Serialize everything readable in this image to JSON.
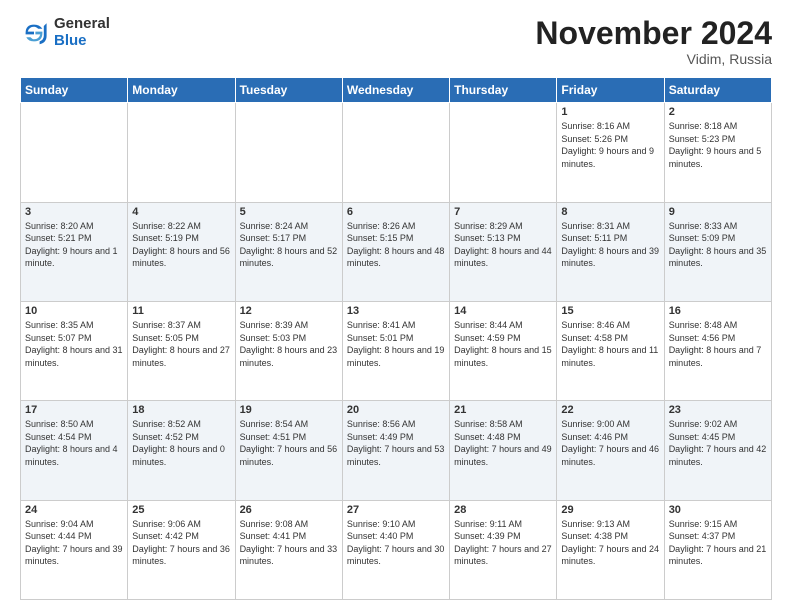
{
  "header": {
    "logo": {
      "general": "General",
      "blue": "Blue"
    },
    "title": "November 2024",
    "location": "Vidim, Russia"
  },
  "calendar": {
    "days_of_week": [
      "Sunday",
      "Monday",
      "Tuesday",
      "Wednesday",
      "Thursday",
      "Friday",
      "Saturday"
    ],
    "weeks": [
      [
        {
          "day": "",
          "info": ""
        },
        {
          "day": "",
          "info": ""
        },
        {
          "day": "",
          "info": ""
        },
        {
          "day": "",
          "info": ""
        },
        {
          "day": "",
          "info": ""
        },
        {
          "day": "1",
          "info": "Sunrise: 8:16 AM\nSunset: 5:26 PM\nDaylight: 9 hours and 9 minutes."
        },
        {
          "day": "2",
          "info": "Sunrise: 8:18 AM\nSunset: 5:23 PM\nDaylight: 9 hours and 5 minutes."
        }
      ],
      [
        {
          "day": "3",
          "info": "Sunrise: 8:20 AM\nSunset: 5:21 PM\nDaylight: 9 hours and 1 minute."
        },
        {
          "day": "4",
          "info": "Sunrise: 8:22 AM\nSunset: 5:19 PM\nDaylight: 8 hours and 56 minutes."
        },
        {
          "day": "5",
          "info": "Sunrise: 8:24 AM\nSunset: 5:17 PM\nDaylight: 8 hours and 52 minutes."
        },
        {
          "day": "6",
          "info": "Sunrise: 8:26 AM\nSunset: 5:15 PM\nDaylight: 8 hours and 48 minutes."
        },
        {
          "day": "7",
          "info": "Sunrise: 8:29 AM\nSunset: 5:13 PM\nDaylight: 8 hours and 44 minutes."
        },
        {
          "day": "8",
          "info": "Sunrise: 8:31 AM\nSunset: 5:11 PM\nDaylight: 8 hours and 39 minutes."
        },
        {
          "day": "9",
          "info": "Sunrise: 8:33 AM\nSunset: 5:09 PM\nDaylight: 8 hours and 35 minutes."
        }
      ],
      [
        {
          "day": "10",
          "info": "Sunrise: 8:35 AM\nSunset: 5:07 PM\nDaylight: 8 hours and 31 minutes."
        },
        {
          "day": "11",
          "info": "Sunrise: 8:37 AM\nSunset: 5:05 PM\nDaylight: 8 hours and 27 minutes."
        },
        {
          "day": "12",
          "info": "Sunrise: 8:39 AM\nSunset: 5:03 PM\nDaylight: 8 hours and 23 minutes."
        },
        {
          "day": "13",
          "info": "Sunrise: 8:41 AM\nSunset: 5:01 PM\nDaylight: 8 hours and 19 minutes."
        },
        {
          "day": "14",
          "info": "Sunrise: 8:44 AM\nSunset: 4:59 PM\nDaylight: 8 hours and 15 minutes."
        },
        {
          "day": "15",
          "info": "Sunrise: 8:46 AM\nSunset: 4:58 PM\nDaylight: 8 hours and 11 minutes."
        },
        {
          "day": "16",
          "info": "Sunrise: 8:48 AM\nSunset: 4:56 PM\nDaylight: 8 hours and 7 minutes."
        }
      ],
      [
        {
          "day": "17",
          "info": "Sunrise: 8:50 AM\nSunset: 4:54 PM\nDaylight: 8 hours and 4 minutes."
        },
        {
          "day": "18",
          "info": "Sunrise: 8:52 AM\nSunset: 4:52 PM\nDaylight: 8 hours and 0 minutes."
        },
        {
          "day": "19",
          "info": "Sunrise: 8:54 AM\nSunset: 4:51 PM\nDaylight: 7 hours and 56 minutes."
        },
        {
          "day": "20",
          "info": "Sunrise: 8:56 AM\nSunset: 4:49 PM\nDaylight: 7 hours and 53 minutes."
        },
        {
          "day": "21",
          "info": "Sunrise: 8:58 AM\nSunset: 4:48 PM\nDaylight: 7 hours and 49 minutes."
        },
        {
          "day": "22",
          "info": "Sunrise: 9:00 AM\nSunset: 4:46 PM\nDaylight: 7 hours and 46 minutes."
        },
        {
          "day": "23",
          "info": "Sunrise: 9:02 AM\nSunset: 4:45 PM\nDaylight: 7 hours and 42 minutes."
        }
      ],
      [
        {
          "day": "24",
          "info": "Sunrise: 9:04 AM\nSunset: 4:44 PM\nDaylight: 7 hours and 39 minutes."
        },
        {
          "day": "25",
          "info": "Sunrise: 9:06 AM\nSunset: 4:42 PM\nDaylight: 7 hours and 36 minutes."
        },
        {
          "day": "26",
          "info": "Sunrise: 9:08 AM\nSunset: 4:41 PM\nDaylight: 7 hours and 33 minutes."
        },
        {
          "day": "27",
          "info": "Sunrise: 9:10 AM\nSunset: 4:40 PM\nDaylight: 7 hours and 30 minutes."
        },
        {
          "day": "28",
          "info": "Sunrise: 9:11 AM\nSunset: 4:39 PM\nDaylight: 7 hours and 27 minutes."
        },
        {
          "day": "29",
          "info": "Sunrise: 9:13 AM\nSunset: 4:38 PM\nDaylight: 7 hours and 24 minutes."
        },
        {
          "day": "30",
          "info": "Sunrise: 9:15 AM\nSunset: 4:37 PM\nDaylight: 7 hours and 21 minutes."
        }
      ]
    ]
  }
}
